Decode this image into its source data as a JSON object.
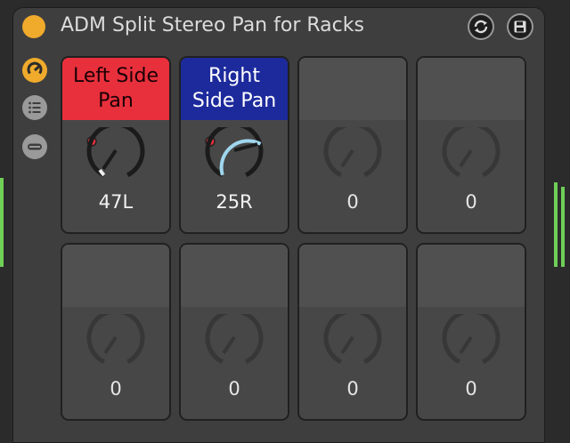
{
  "device": {
    "title": "ADM Split Stereo Pan for Racks",
    "colors": {
      "activator": "#f0aa2c",
      "accent_arc": "#9fd6ee",
      "label_red": "#e8303c",
      "label_blue": "#1d2a9c",
      "mapped_dot": "#e8303c"
    }
  },
  "header_buttons": [
    {
      "icon": "randomize-icon"
    },
    {
      "icon": "save-icon"
    }
  ],
  "side_buttons": [
    {
      "icon": "macro-view-icon",
      "active": true
    },
    {
      "icon": "list-icon",
      "active": false
    },
    {
      "icon": "minimize-icon",
      "active": false
    }
  ],
  "macros": [
    {
      "label": "Left Side\nPan",
      "value": "47L",
      "mapped": true,
      "color": "red"
    },
    {
      "label": "Right\nSide Pan",
      "value": "25R",
      "mapped": true,
      "color": "blue"
    },
    {
      "label": "",
      "value": "0",
      "mapped": false,
      "color": "empty"
    },
    {
      "label": "",
      "value": "0",
      "mapped": false,
      "color": "empty"
    },
    {
      "label": "",
      "value": "0",
      "mapped": false,
      "color": "empty"
    },
    {
      "label": "",
      "value": "0",
      "mapped": false,
      "color": "empty"
    },
    {
      "label": "",
      "value": "0",
      "mapped": false,
      "color": "empty"
    },
    {
      "label": "",
      "value": "0",
      "mapped": false,
      "color": "empty"
    }
  ]
}
